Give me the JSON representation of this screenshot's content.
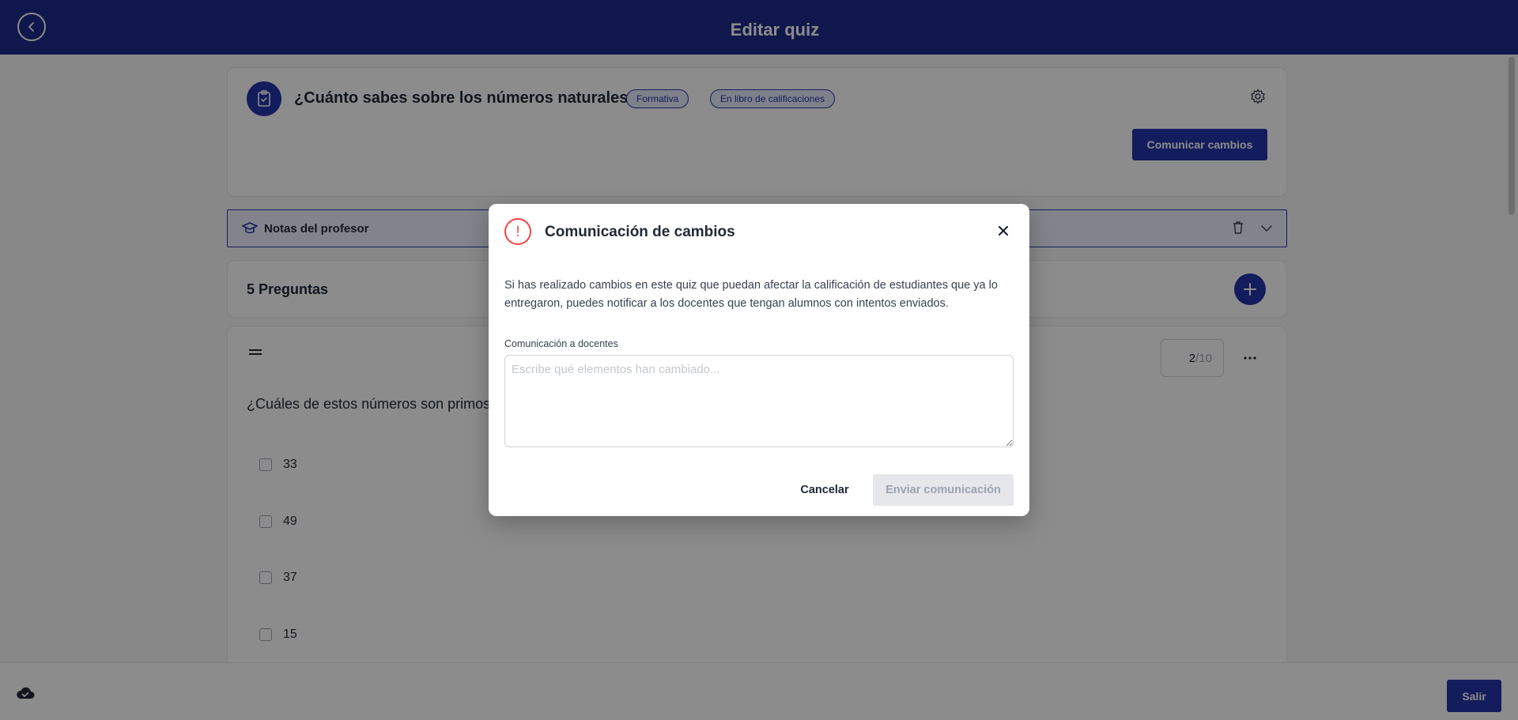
{
  "header": {
    "title": "Editar quiz",
    "back_icon": "chevron-left-icon"
  },
  "quiz": {
    "title": "¿Cuánto sabes sobre los números naturales?",
    "badges": [
      "Formativa",
      "En libro de calificaciones"
    ],
    "comunicar_label": "Comunicar cambios"
  },
  "notes": {
    "label": "Notas del profesor"
  },
  "questions": {
    "title": "5 Preguntas"
  },
  "question": {
    "text": "¿Cuáles de estos números son primos?",
    "points_current": "2",
    "points_max": "/10",
    "options": [
      "33",
      "49",
      "37",
      "15"
    ]
  },
  "footer": {
    "salir_label": "Salir"
  },
  "modal": {
    "title": "Comunicación de cambios",
    "description": "Si has realizado cambios en este quiz que puedan afectar la calificación de estudiantes que ya lo entregaron, puedes notificar a los docentes que tengan alumnos con intentos enviados.",
    "field_label": "Comunicación a docentes",
    "placeholder": "Escribe qué elementos han cambiado...",
    "cancel_label": "Cancelar",
    "send_label": "Enviar comunicación"
  },
  "colors": {
    "brand": "#2433a8",
    "header": "#1e2a8a",
    "warning": "#ef4444"
  }
}
